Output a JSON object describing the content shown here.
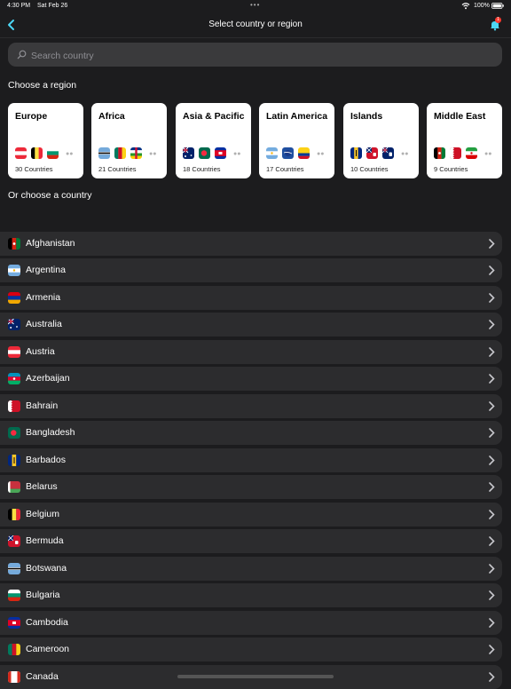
{
  "status_bar": {
    "time": "4:30 PM",
    "date": "Sat Feb 26",
    "battery": "100%"
  },
  "nav": {
    "title": "Select country or region",
    "notification_count": "1"
  },
  "search": {
    "placeholder": "Search country"
  },
  "labels": {
    "choose_region": "Choose a region",
    "choose_country": "Or choose a country"
  },
  "regions": [
    {
      "name": "Europe",
      "count": "30 Countries"
    },
    {
      "name": "Africa",
      "count": "21 Countries"
    },
    {
      "name": "Asia & Pacific",
      "count": "18 Countries"
    },
    {
      "name": "Latin America",
      "count": "17 Countries"
    },
    {
      "name": "Islands",
      "count": "10 Countries"
    },
    {
      "name": "Middle East",
      "count": "9 Countries"
    }
  ],
  "countries": [
    {
      "name": "Afghanistan"
    },
    {
      "name": "Argentina"
    },
    {
      "name": "Armenia"
    },
    {
      "name": "Australia"
    },
    {
      "name": "Austria"
    },
    {
      "name": "Azerbaijan"
    },
    {
      "name": "Bahrain"
    },
    {
      "name": "Bangladesh"
    },
    {
      "name": "Barbados"
    },
    {
      "name": "Belarus"
    },
    {
      "name": "Belgium"
    },
    {
      "name": "Bermuda"
    },
    {
      "name": "Botswana"
    },
    {
      "name": "Bulgaria"
    },
    {
      "name": "Cambodia"
    },
    {
      "name": "Cameroon"
    },
    {
      "name": "Canada"
    }
  ],
  "colors": {
    "background": "#1c1c1e",
    "row": "#2c2c2e",
    "accent": "#4cd7f5",
    "badge": "#ff3b30"
  }
}
